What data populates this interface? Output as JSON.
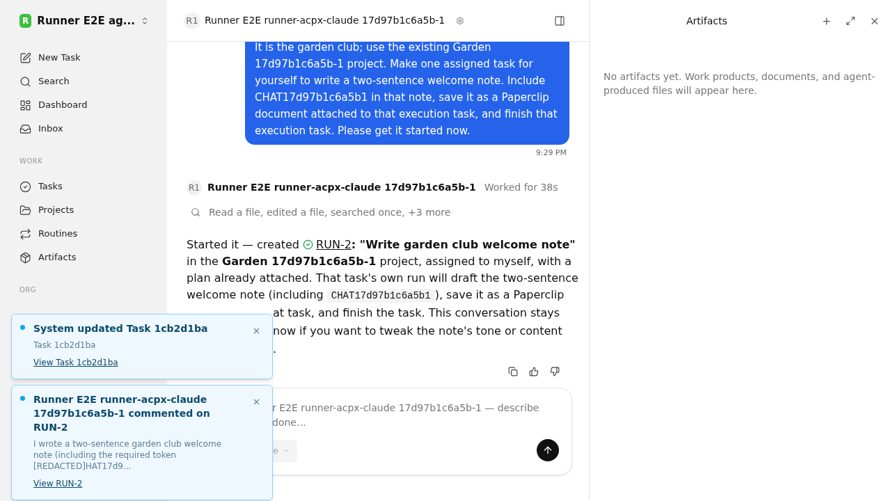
{
  "workspace": {
    "logo_letter": "R",
    "name": "Runner E2E ag..."
  },
  "nav": [
    {
      "label": "New Task"
    },
    {
      "label": "Search"
    },
    {
      "label": "Dashboard"
    },
    {
      "label": "Inbox"
    }
  ],
  "sections": [
    {
      "title": "WORK",
      "items": [
        {
          "label": "Tasks"
        },
        {
          "label": "Projects"
        },
        {
          "label": "Routines"
        },
        {
          "label": "Artifacts"
        }
      ]
    },
    {
      "title": "ORG"
    }
  ],
  "header": {
    "avatar": "R1",
    "title": "Runner E2E runner-acpx-claude 17d97b1c6a5b-1"
  },
  "user_message": {
    "text": "It is the garden club; use the existing Garden 17d97b1c6a5b-1 project. Make one assigned task for yourself to write a two-sentence welcome note. Include CHAT17d97b1c6a5b1 in that note, save it as a Paperclip document attached to that execution task, and finish that execution task. Please get it started now.",
    "time": "9:29 PM"
  },
  "assistant": {
    "avatar": "R1",
    "name": "Runner E2E runner-acpx-claude 17d97b1c6a5b-1",
    "duration": "Worked for 38s",
    "activity": "Read a file, edited a file, searched once, +3 more",
    "lines": [
      {
        "covered": false,
        "parts": [
          {
            "kind": "text",
            "text": "Started it — created "
          },
          {
            "kind": "task_link",
            "text": "RUN-2"
          },
          {
            "kind": "text",
            "text": "**: \"Write garden club welcome note\"**"
          }
        ]
      },
      {
        "covered": false,
        "parts": [
          {
            "kind": "text",
            "text": "in the **Garden 17d97b1c6a5b-1** project, assigned to myself, with a"
          }
        ]
      },
      {
        "covered": false,
        "parts": [
          {
            "kind": "text",
            "text": "plan already attached. That task's own run will draft the two-sentence"
          }
        ]
      },
      {
        "covered": false,
        "parts": [
          {
            "kind": "text",
            "text": "welcome note (including "
          },
          {
            "kind": "code",
            "text": "CHAT17d97b1c6a5b1"
          },
          {
            "kind": "text",
            "text": "), save it as a Paperclip"
          }
        ]
      },
      {
        "covered": true,
        "parts": [
          {
            "kind": "text",
            "text": "at task, and finish the task. This conversation stays"
          }
        ]
      },
      {
        "covered": true,
        "parts": [
          {
            "kind": "text",
            "text": "now if you want to tweak the note's tone or content"
          }
        ]
      },
      {
        "covered": true,
        "parts": [
          {
            "kind": "text",
            "text": "."
          }
        ]
      }
    ]
  },
  "composer": {
    "placeholder": [
      "r E2E runner-acpx-claude 17d97b1c6a5b-1 — describe",
      "done…"
    ],
    "selector": "e"
  },
  "artifacts": {
    "title": "Artifacts",
    "empty_text": "No artifacts yet. Work products, documents, and agent-produced files will appear here."
  },
  "toasts": [
    {
      "unread": true,
      "title": "System updated Task 1cb2d1ba",
      "body": "Task 1cb2d1ba",
      "link": "View Task 1cb2d1ba"
    },
    {
      "unread": true,
      "title": "Runner E2E runner-acpx-claude 17d97b1c6a5b-1 commented on RUN-2",
      "body": "I wrote a two-sentence garden club welcome note (including the required token [REDACTED]HAT17d9...",
      "link": "View RUN-2"
    }
  ]
}
